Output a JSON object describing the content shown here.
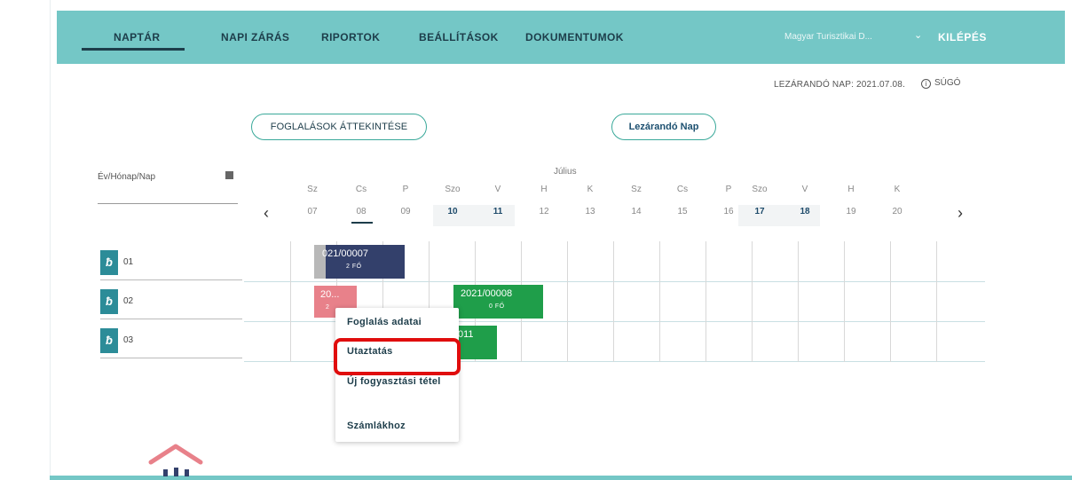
{
  "nav": {
    "items": [
      {
        "label": "NAPTÁR",
        "active": true
      },
      {
        "label": "NAPI ZÁRÁS"
      },
      {
        "label": "RIPORTOK"
      },
      {
        "label": "BEÁLLÍTÁSOK"
      },
      {
        "label": "DOKUMENTUMOK"
      }
    ],
    "account": "Magyar Turisztikai D...",
    "logout": "KILÉPÉS"
  },
  "subheader": {
    "closing_day": "LEZÁRANDÓ NAP: 2021.07.08.",
    "help": "SÚGÓ"
  },
  "buttons": {
    "overview": "FOGLALÁSOK ÁTTEKINTÉSE",
    "closing_day": "Lezárandó Nap"
  },
  "date_picker": {
    "placeholder": "Év/Hónap/Nap",
    "icon": "calendar-icon"
  },
  "calendar": {
    "month": "Július",
    "days": [
      {
        "name": "Sz",
        "date": "07"
      },
      {
        "name": "Cs",
        "date": "08",
        "today": true
      },
      {
        "name": "P",
        "date": "09"
      },
      {
        "name": "Szo",
        "date": "10",
        "weekend": true
      },
      {
        "name": "V",
        "date": "11",
        "weekend": true
      },
      {
        "name": "H",
        "date": "12"
      },
      {
        "name": "K",
        "date": "13"
      },
      {
        "name": "Sz",
        "date": "14"
      },
      {
        "name": "Cs",
        "date": "15"
      },
      {
        "name": "P",
        "date": "16"
      },
      {
        "name": "Szo",
        "date": "17",
        "weekend": true
      },
      {
        "name": "V",
        "date": "18",
        "weekend": true
      },
      {
        "name": "H",
        "date": "19"
      },
      {
        "name": "K",
        "date": "20"
      }
    ]
  },
  "rooms": [
    {
      "number": "01"
    },
    {
      "number": "02"
    },
    {
      "number": "03"
    }
  ],
  "bookings": [
    {
      "id": "2021/00007",
      "id_shown": "021/00007",
      "persons": "2 FŐ",
      "color": "#33406b"
    },
    {
      "id": "20...",
      "persons": "2",
      "color": "#e8818a"
    },
    {
      "id": "2021/00008",
      "persons": "0 FŐ",
      "color": "#1f9e4a"
    },
    {
      "id": "011",
      "persons": "",
      "color": "#1f9e4a"
    }
  ],
  "context_menu": {
    "items": [
      "Foglalás adatai",
      "Utaztatás",
      "Új fogyasztási tétel",
      "Számlákhoz"
    ],
    "highlighted": "Utaztatás"
  },
  "colors": {
    "accent": "#74c7c6",
    "dark": "#1d3d4a",
    "key": "#2c8c98",
    "highlight": "#e00d0d"
  }
}
